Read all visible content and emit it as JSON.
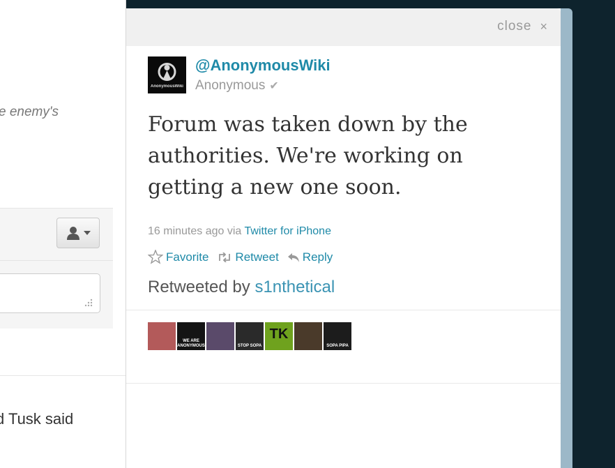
{
  "background_left": {
    "italic_snippet": "e enemy's",
    "bottom_snippet": "d Tusk said",
    "user_menu_icon": "user-icon"
  },
  "dialog": {
    "close_label": "close",
    "close_icon": "×"
  },
  "tweet": {
    "screen_name": "@AnonymousWiki",
    "display_name": "Anonymous",
    "verified_glyph": "✔",
    "avatar_text": "AnonymousWiki",
    "text": "Forum was taken down by the authorities. We're working on getting a new one soon.",
    "time": "16 minutes ago",
    "via": "via",
    "source": "Twitter for iPhone",
    "actions": {
      "favorite": "Favorite",
      "retweet": "Retweet",
      "reply": "Reply"
    },
    "retweeted_by_prefix": "Retweeted by",
    "retweeted_by_user": "s1nthetical",
    "retweeter_avatars": [
      {
        "color": "#b35a5a"
      },
      {
        "color": "#141414",
        "label": "WE ARE ANONYMOUS"
      },
      {
        "color": "#5a4a6a"
      },
      {
        "color": "#2a2a2a",
        "label": "STOP SOPA"
      },
      {
        "color": "#6fa21e",
        "label": "TK"
      },
      {
        "color": "#4a3a2a"
      },
      {
        "color": "#1c1c1c",
        "label": "SOPA PIPA"
      }
    ]
  },
  "colors": {
    "link": "#1f8aa8",
    "page_bg": "#0e232d",
    "header_bg": "#f0f0f0"
  }
}
